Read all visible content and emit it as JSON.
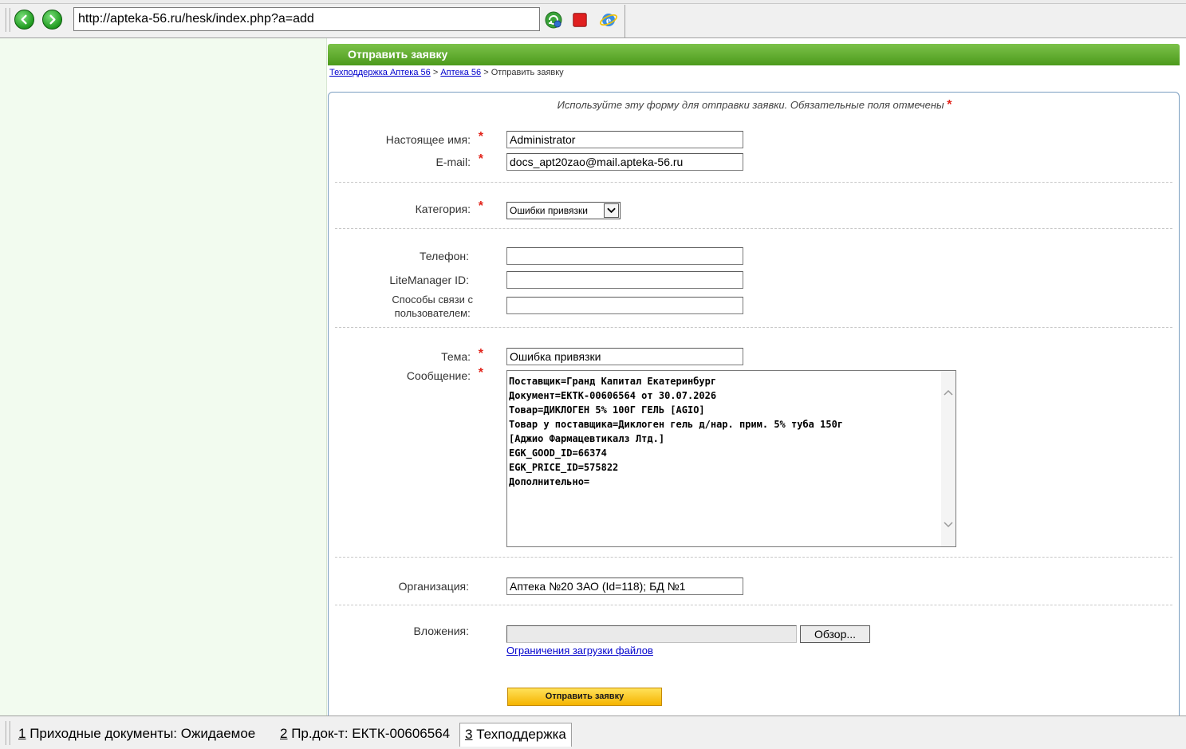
{
  "browser": {
    "url": "http://apteka-56.ru/hesk/index.php?a=add"
  },
  "page": {
    "header_title": "Отправить заявку",
    "breadcrumb": {
      "home": "Техподдержка Аптека 56",
      "section": "Аптека 56",
      "current": "Отправить заявку",
      "separator": ">"
    },
    "intro": "Используйте эту форму для отправки заявки. Обязательные поля отмечены",
    "required_mark": "*"
  },
  "form": {
    "name_label": "Настоящее имя:",
    "name_value": "Administrator",
    "email_label": "E-mail:",
    "email_value": "docs_apt20zao@mail.apteka-56.ru",
    "category_label": "Категория:",
    "category_value": "Ошибки привязки",
    "phone_label": "Телефон:",
    "phone_value": "",
    "litemanager_label": "LiteManager ID:",
    "litemanager_value": "",
    "contact_label_line1": "Способы связи с",
    "contact_label_line2": "пользователем:",
    "contact_value": "",
    "subject_label": "Тема:",
    "subject_value": "Ошибка привязки",
    "message_label": "Сообщение:",
    "message_value": "Поставщик=Гранд Капитал Екатеринбург\nДокумент=ЕКТК-00606564 от 30.07.2026\nТовар=ДИКЛОГЕН 5% 100Г ГЕЛЬ [AGIO]\nТовар у поставщика=Диклоген гель д/нар. прим. 5% туба 150г\n[Аджио Фармацевтикалз Лтд.]\nEGK_GOOD_ID=66374\nEGK_PRICE_ID=575822\nДополнительно=",
    "org_label": "Организация:",
    "org_value": "Аптека №20 ЗАО (Id=118); БД №1",
    "attachments_label": "Вложения:",
    "browse_label": "Обзор...",
    "upload_limits_link": "Ограничения загрузки файлов",
    "submit_label": "Отправить заявку"
  },
  "taskbar": {
    "tabs": [
      {
        "num": "1",
        "label": " Приходные документы: Ожидаемое",
        "active": false
      },
      {
        "num": "2",
        "label": " Пр.док-т: ЕКТК-00606564",
        "active": false
      },
      {
        "num": "3",
        "label": " Техподдержка",
        "active": true
      }
    ]
  },
  "colors": {
    "header_green": "#5aa82a",
    "left_panel_bg": "#f2fbef",
    "required_red": "#e2231a",
    "link_blue": "#0000cc",
    "submit_yellow": "#f5b400"
  }
}
